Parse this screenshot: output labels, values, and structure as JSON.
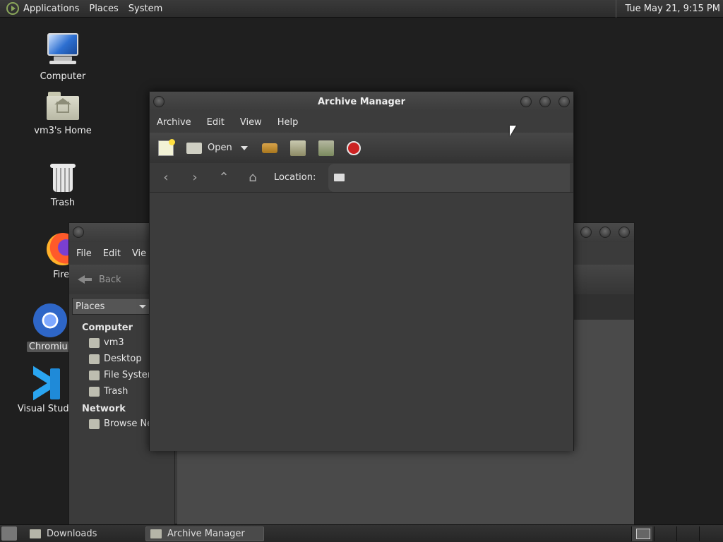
{
  "top_panel": {
    "menus": [
      "Applications",
      "Places",
      "System"
    ],
    "clock": "Tue May 21,  9:15 PM"
  },
  "desktop": {
    "icons": [
      {
        "label": "Computer",
        "icon": "computer-icon"
      },
      {
        "label": "vm3's Home",
        "icon": "home-folder-icon"
      },
      {
        "label": "Trash",
        "icon": "trash-icon"
      },
      {
        "label": "Firef",
        "icon": "firefox-icon"
      },
      {
        "label": "Chromiur",
        "icon": "chromium-icon"
      },
      {
        "label": "Visual Studio",
        "icon": "vscode-icon"
      }
    ]
  },
  "file_manager": {
    "menus": [
      "File",
      "Edit",
      "Vie"
    ],
    "back_label": "Back",
    "places_select": "Places",
    "sidebar": {
      "computer_heading": "Computer",
      "computer_items": [
        "vm3",
        "Desktop",
        "File Systen",
        "Trash"
      ],
      "network_heading": "Network",
      "network_items": [
        "Browse Ne"
      ]
    }
  },
  "archive_manager": {
    "title": "Archive Manager",
    "menus": [
      "Archive",
      "Edit",
      "View",
      "Help"
    ],
    "toolbar": {
      "open_label": "Open",
      "icons": [
        "new-archive-icon",
        "open-archive-icon",
        "extract-icon",
        "add-files-icon",
        "add-folder-icon",
        "stop-icon"
      ]
    },
    "location_label": "Location:",
    "location_value": ""
  },
  "taskbar": {
    "tasks": [
      {
        "label": "Downloads",
        "active": false
      },
      {
        "label": "Archive Manager",
        "active": true
      }
    ]
  }
}
